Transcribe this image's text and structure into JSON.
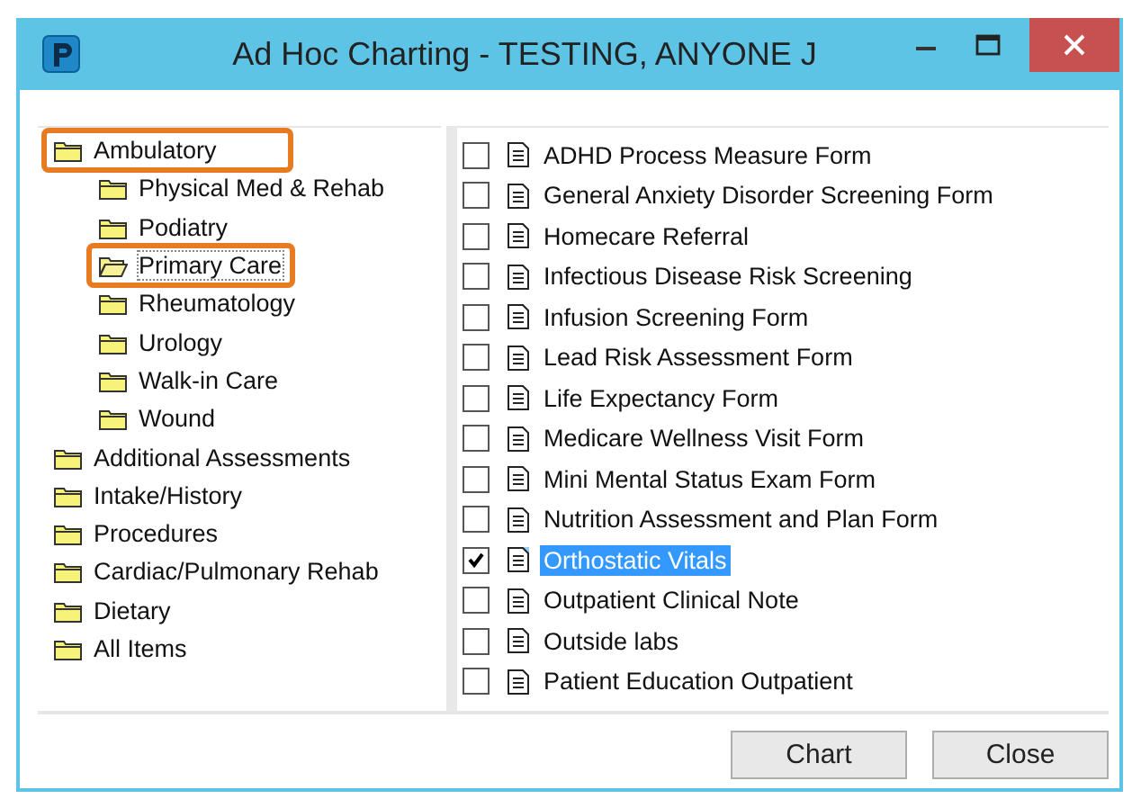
{
  "window": {
    "title": "Ad Hoc Charting - TESTING, ANYONE J"
  },
  "tree": [
    {
      "label": "Ambulatory",
      "selected": false,
      "highlighted": true,
      "children": [
        {
          "label": "Physical Med & Rehab",
          "selected": false,
          "highlighted": false
        },
        {
          "label": "Podiatry",
          "selected": false,
          "highlighted": false
        },
        {
          "label": "Primary Care",
          "selected": true,
          "highlighted": true
        },
        {
          "label": "Rheumatology",
          "selected": false,
          "highlighted": false
        },
        {
          "label": "Urology",
          "selected": false,
          "highlighted": false
        },
        {
          "label": "Walk-in Care",
          "selected": false,
          "highlighted": false
        },
        {
          "label": "Wound",
          "selected": false,
          "highlighted": false
        }
      ]
    },
    {
      "label": "Additional Assessments",
      "selected": false,
      "highlighted": false
    },
    {
      "label": "Intake/History",
      "selected": false,
      "highlighted": false
    },
    {
      "label": "Procedures",
      "selected": false,
      "highlighted": false
    },
    {
      "label": "Cardiac/Pulmonary Rehab",
      "selected": false,
      "highlighted": false
    },
    {
      "label": "Dietary",
      "selected": false,
      "highlighted": false
    },
    {
      "label": "All Items",
      "selected": false,
      "highlighted": false
    }
  ],
  "forms": [
    {
      "label": "ADHD Process Measure Form",
      "checked": false,
      "selected": false
    },
    {
      "label": "General Anxiety Disorder Screening Form",
      "checked": false,
      "selected": false
    },
    {
      "label": "Homecare Referral",
      "checked": false,
      "selected": false
    },
    {
      "label": "Infectious Disease Risk Screening",
      "checked": false,
      "selected": false
    },
    {
      "label": "Infusion Screening Form",
      "checked": false,
      "selected": false
    },
    {
      "label": "Lead Risk Assessment Form",
      "checked": false,
      "selected": false
    },
    {
      "label": "Life Expectancy Form",
      "checked": false,
      "selected": false
    },
    {
      "label": "Medicare Wellness Visit Form",
      "checked": false,
      "selected": false
    },
    {
      "label": "Mini Mental Status Exam Form",
      "checked": false,
      "selected": false
    },
    {
      "label": "Nutrition Assessment and Plan Form",
      "checked": false,
      "selected": false
    },
    {
      "label": "Orthostatic Vitals",
      "checked": true,
      "selected": true
    },
    {
      "label": "Outpatient Clinical Note",
      "checked": false,
      "selected": false
    },
    {
      "label": "Outside labs",
      "checked": false,
      "selected": false
    },
    {
      "label": "Patient Education Outpatient",
      "checked": false,
      "selected": false
    }
  ],
  "buttons": [
    "Chart",
    "Close"
  ]
}
